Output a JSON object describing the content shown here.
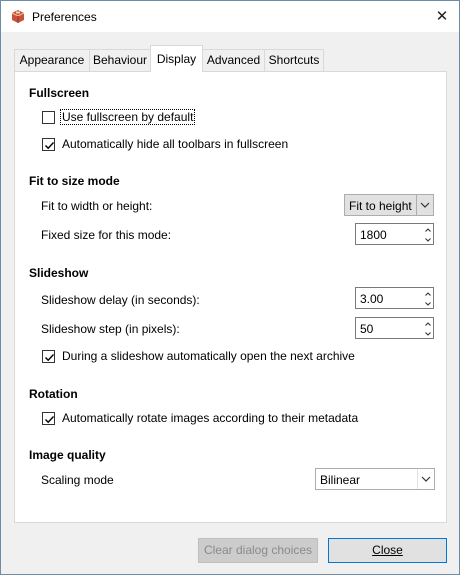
{
  "window": {
    "title": "Preferences",
    "icon": "app-box-icon",
    "close_icon": "close-icon"
  },
  "tabs": [
    {
      "label": "Appearance"
    },
    {
      "label": "Behaviour"
    },
    {
      "label": "Display"
    },
    {
      "label": "Advanced"
    },
    {
      "label": "Shortcuts"
    }
  ],
  "active_tab": "Display",
  "fullscreen": {
    "title": "Fullscreen",
    "use_fullscreen_label": "Use fullscreen by default",
    "use_fullscreen_checked": false,
    "hide_toolbars_label": "Automatically hide all toolbars in fullscreen",
    "hide_toolbars_checked": true
  },
  "fit": {
    "title": "Fit to size mode",
    "fit_label": "Fit to width or height:",
    "fit_value": "Fit to height",
    "fixed_label": "Fixed size for this mode:",
    "fixed_value": "1800"
  },
  "slideshow": {
    "title": "Slideshow",
    "delay_label": "Slideshow delay (in seconds):",
    "delay_value": "3.00",
    "step_label": "Slideshow step (in pixels):",
    "step_value": "50",
    "open_next_label": "During a slideshow automatically open the next archive",
    "open_next_checked": true
  },
  "rotation": {
    "title": "Rotation",
    "auto_rotate_label": "Automatically rotate images according to their metadata",
    "auto_rotate_checked": true
  },
  "quality": {
    "title": "Image quality",
    "scaling_label": "Scaling mode",
    "scaling_value": "Bilinear"
  },
  "buttons": {
    "clear_label": "Clear dialog choices",
    "close_label": "Close"
  },
  "colors": {
    "accent": "#0078d7",
    "check": "#000000"
  }
}
